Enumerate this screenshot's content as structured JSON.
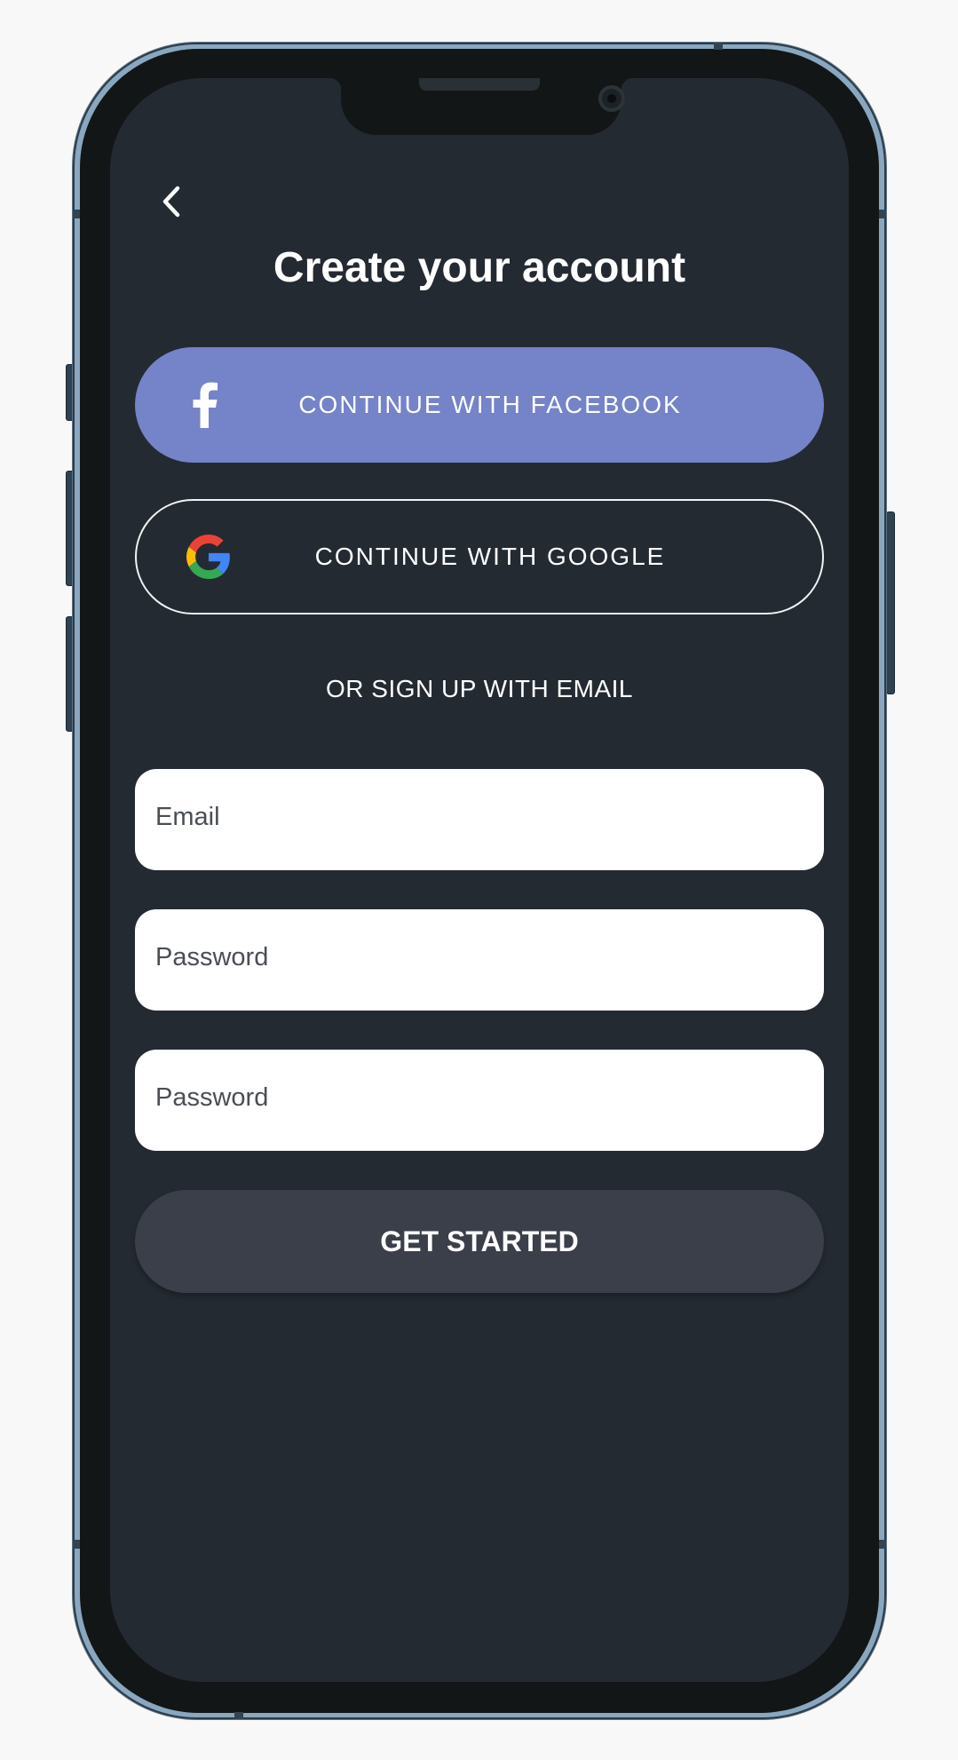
{
  "header": {
    "back_icon": "chevron-left-icon",
    "title": "Create your account"
  },
  "social": {
    "facebook_label": "CONTINUE WITH FACEBOOK",
    "facebook_icon": "facebook-icon",
    "facebook_color": "#7583c9",
    "google_label": "CONTINUE WITH GOOGLE",
    "google_icon": "google-icon"
  },
  "divider": {
    "text": "OR SIGN UP WITH EMAIL"
  },
  "form": {
    "email_placeholder": "Email",
    "password_placeholder": "Password",
    "confirm_password_placeholder": "Password",
    "submit_label": "GET STARTED"
  },
  "theme": {
    "background": "#242a32",
    "button_dark": "#3b3f49",
    "text": "#ffffff"
  }
}
